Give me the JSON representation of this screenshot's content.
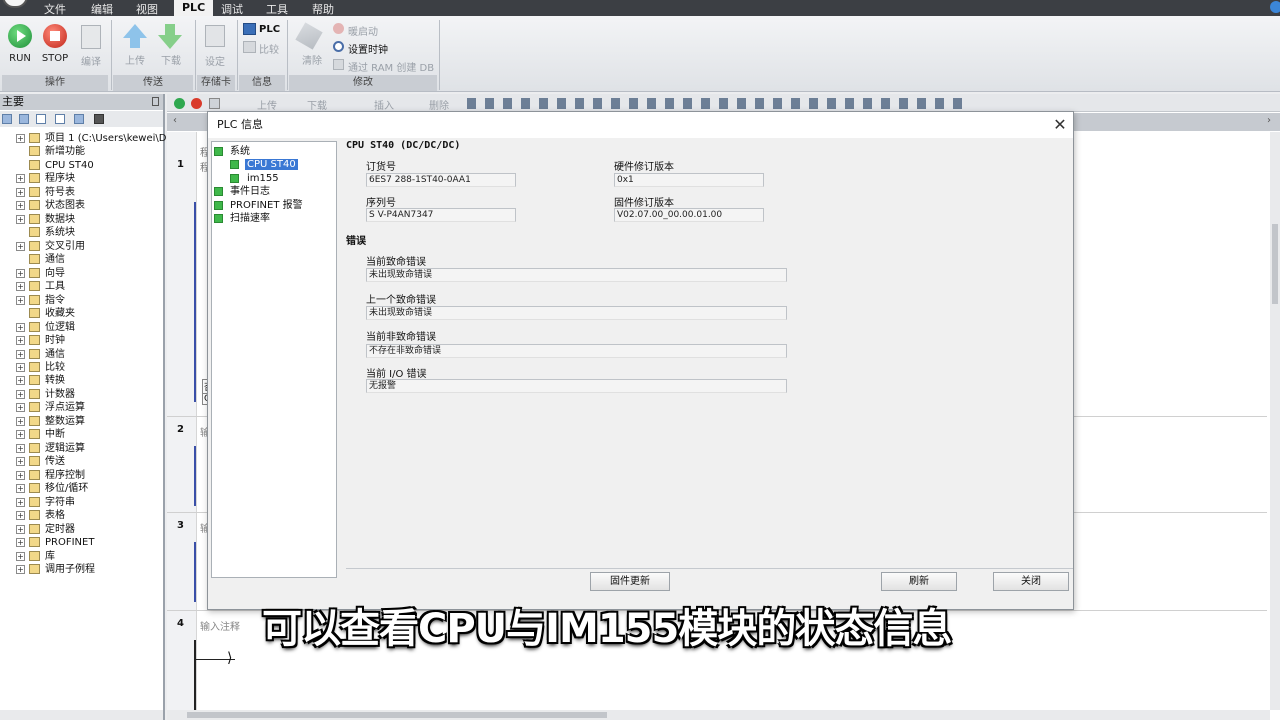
{
  "menubar": {
    "items": [
      "文件",
      "编辑",
      "视图",
      "PLC",
      "调试",
      "工具",
      "帮助"
    ],
    "active": "PLC"
  },
  "ribbon": {
    "groups": [
      {
        "label": "操作",
        "buttons": [
          "RUN",
          "STOP",
          "编译"
        ]
      },
      {
        "label": "传送",
        "buttons": [
          "上传",
          "下载"
        ]
      },
      {
        "label": "存储卡",
        "buttons": [
          "设定"
        ]
      },
      {
        "label": "信息",
        "buttons": [
          "PLC",
          "比较"
        ]
      },
      {
        "label": "修改",
        "buttons": [
          "清除",
          "暖启动",
          "设置时钟",
          "通过 RAM 创建 DB"
        ]
      }
    ]
  },
  "left_pane": {
    "title": "主要",
    "tree": [
      {
        "label": "项目 1 (C:\\Users\\kewei\\Desktop"
      },
      {
        "label": "新增功能"
      },
      {
        "label": "CPU ST40"
      },
      {
        "label": "程序块"
      },
      {
        "label": "符号表"
      },
      {
        "label": "状态图表"
      },
      {
        "label": "数据块"
      },
      {
        "label": "系统块"
      },
      {
        "label": "交叉引用"
      },
      {
        "label": "通信"
      },
      {
        "label": "向导"
      },
      {
        "label": "工具"
      },
      {
        "label": "指令"
      },
      {
        "label": "收藏夹"
      },
      {
        "label": "位逻辑"
      },
      {
        "label": "时钟"
      },
      {
        "label": "通信"
      },
      {
        "label": "比较"
      },
      {
        "label": "转换"
      },
      {
        "label": "计数器"
      },
      {
        "label": "浮点运算"
      },
      {
        "label": "整数运算"
      },
      {
        "label": "中断"
      },
      {
        "label": "逻辑运算"
      },
      {
        "label": "传送"
      },
      {
        "label": "程序控制"
      },
      {
        "label": "移位/循环"
      },
      {
        "label": "字符串"
      },
      {
        "label": "表格"
      },
      {
        "label": "定时器"
      },
      {
        "label": "PROFINET"
      },
      {
        "label": "库"
      },
      {
        "label": "调用子例程"
      }
    ]
  },
  "editor": {
    "toolbar_items": [
      "上传",
      "下载",
      "插入",
      "删除"
    ],
    "rungs": [
      {
        "num": "1",
        "label": "程"
      },
      {
        "num": "2",
        "label": "输"
      },
      {
        "num": "3",
        "label": "输"
      },
      {
        "num": "4",
        "label": "输入注释"
      }
    ],
    "partial_labels": [
      "程",
      "否",
      "C"
    ]
  },
  "dialog": {
    "title": "PLC 信息",
    "close_glyph": "✕",
    "tree": [
      {
        "label": "系统"
      },
      {
        "label": "CPU ST40",
        "selected": true
      },
      {
        "label": "im155"
      },
      {
        "label": "事件日志"
      },
      {
        "label": "PROFINET 报警"
      },
      {
        "label": "扫描速率"
      }
    ],
    "heading": "CPU ST40 (DC/DC/DC)",
    "order_number": {
      "label": "订货号",
      "value": "6ES7 288-1ST40-0AA1"
    },
    "hw_revision": {
      "label": "硬件修订版本",
      "value": "0x1"
    },
    "serial_number": {
      "label": "序列号",
      "value": "S V-P4AN7347"
    },
    "fw_revision": {
      "label": "固件修订版本",
      "value": "V02.07.00_00.00.01.00"
    },
    "errors_heading": "错误",
    "current_fatal": {
      "label": "当前致命错误",
      "value": "未出现致命错误"
    },
    "previous_fatal": {
      "label": "上一个致命错误",
      "value": "未出现致命错误"
    },
    "current_nonfatal": {
      "label": "当前非致命错误",
      "value": "不存在非致命错误"
    },
    "current_io": {
      "label": "当前 I/O 错误",
      "value": "无报警"
    },
    "buttons": {
      "firmware_update": "固件更新",
      "refresh": "刷新",
      "close": "关闭"
    }
  },
  "subtitle": "可以查看CPU与IM155模块的状态信息",
  "colors": {
    "run": "#2fa84f",
    "stop": "#d93b2b",
    "selection": "#3a78d4",
    "menubar": "#3c3f44"
  }
}
